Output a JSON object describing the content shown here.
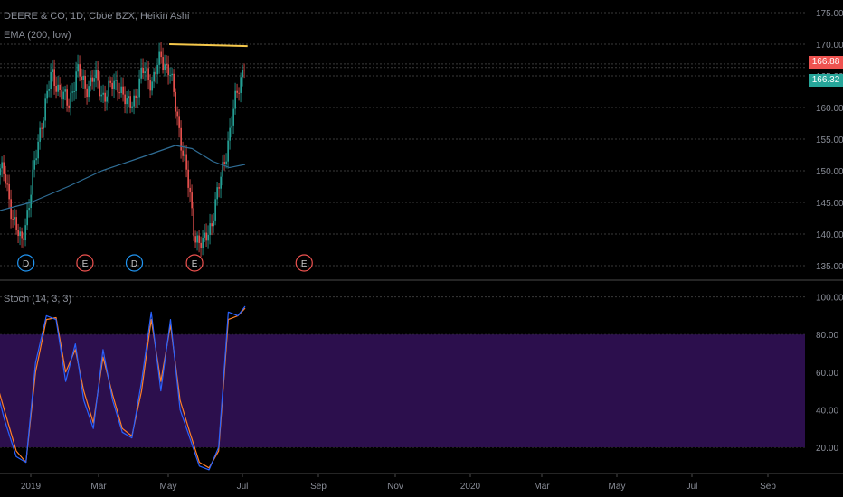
{
  "colors": {
    "background": "#000000",
    "grid": "#3a3a3a",
    "axis_text": "#8a8e98",
    "up_candle": "#26a69a",
    "down_candle": "#ef5350",
    "ema_line": "#2f6d95",
    "resistance_line": "#f5c84b",
    "stoch_k": "#2962ff",
    "stoch_d": "#ff7f27",
    "stoch_band": "#2c0f4d",
    "divider": "#4a4a4a",
    "dividend_marker": "#2196f3",
    "earnings_marker": "#ef5350"
  },
  "legend": {
    "main_title": "DEERE & CO, 1D, Cboe BZX, Heikin Ashi",
    "ema_label": "EMA (200, low)",
    "stoch_label": "Stoch (14, 3, 3)"
  },
  "price_badges": {
    "upper": "166.88",
    "lower": "166.32"
  },
  "chart_data": [
    {
      "type": "candlestick",
      "subtype": "Heikin Ashi",
      "title": "DEERE & CO, 1D, Cboe BZX, Heikin Ashi",
      "ylim": [
        133,
        177
      ],
      "y_ticks": [
        "135.00",
        "140.00",
        "145.00",
        "150.00",
        "155.00",
        "160.00",
        "165.00",
        "170.00",
        "175.00"
      ],
      "grid": true,
      "series": [
        {
          "name": "Heikin Ashi price (approx. close path)",
          "x": [
            "2018-12-02",
            "2018-12-10",
            "2018-12-17",
            "2018-12-24",
            "2019-01-02",
            "2019-01-10",
            "2019-01-18",
            "2019-01-25",
            "2019-02-01",
            "2019-02-08",
            "2019-02-15",
            "2019-02-22",
            "2019-03-01",
            "2019-03-08",
            "2019-03-15",
            "2019-03-22",
            "2019-03-29",
            "2019-04-05",
            "2019-04-12",
            "2019-04-19",
            "2019-04-26",
            "2019-05-03",
            "2019-05-10",
            "2019-05-17",
            "2019-05-24",
            "2019-05-31",
            "2019-06-07",
            "2019-06-14",
            "2019-06-21",
            "2019-06-28"
          ],
          "values": [
            152,
            149,
            143,
            138,
            148,
            158,
            165,
            163,
            160,
            166,
            163,
            165,
            162,
            163,
            164,
            160,
            162,
            166,
            164,
            168,
            166,
            158,
            150,
            140,
            138,
            142,
            148,
            155,
            162,
            168
          ]
        },
        {
          "name": "EMA (200, low)",
          "x": [
            "2018-12-02",
            "2019-01-01",
            "2019-02-01",
            "2019-03-01",
            "2019-04-01",
            "2019-05-01",
            "2019-05-15",
            "2019-06-01",
            "2019-06-15",
            "2019-06-28"
          ],
          "values": [
            143.5,
            145,
            147.5,
            150,
            152,
            154,
            153.5,
            151.5,
            150.5,
            151
          ]
        },
        {
          "name": "Resistance line",
          "x": [
            "2019-04-26",
            "2019-06-30"
          ],
          "values": [
            170.0,
            169.7
          ]
        }
      ],
      "markers": [
        {
          "label": "D",
          "x": "2018-12-28",
          "kind": "dividend"
        },
        {
          "label": "E",
          "x": "2019-02-15",
          "kind": "earnings"
        },
        {
          "label": "D",
          "x": "2019-03-28",
          "kind": "dividend"
        },
        {
          "label": "E",
          "x": "2019-05-17",
          "kind": "earnings"
        },
        {
          "label": "E",
          "x": "2019-08-16",
          "kind": "earnings"
        }
      ]
    },
    {
      "type": "line",
      "title": "Stoch (14, 3, 3)",
      "ylim": [
        7,
        108
      ],
      "y_ticks": [
        "20.00",
        "40.00",
        "60.00",
        "80.00",
        "100.00"
      ],
      "band": [
        20,
        80
      ],
      "grid": true,
      "x_tick_labels": [
        "2019",
        "Mar",
        "May",
        "Jul",
        "Sep",
        "Nov",
        "2020",
        "Mar",
        "May",
        "Jul",
        "Sep"
      ],
      "series": [
        {
          "name": "%K",
          "x": [
            "2018-12-02",
            "2018-12-10",
            "2018-12-20",
            "2018-12-28",
            "2019-01-05",
            "2019-01-14",
            "2019-01-22",
            "2019-01-30",
            "2019-02-07",
            "2019-02-14",
            "2019-02-22",
            "2019-03-02",
            "2019-03-10",
            "2019-03-18",
            "2019-03-26",
            "2019-04-03",
            "2019-04-11",
            "2019-04-19",
            "2019-04-27",
            "2019-05-05",
            "2019-05-13",
            "2019-05-21",
            "2019-05-29",
            "2019-06-06",
            "2019-06-14",
            "2019-06-22",
            "2019-06-28"
          ],
          "values": [
            55,
            35,
            15,
            12,
            65,
            90,
            88,
            55,
            75,
            45,
            30,
            72,
            45,
            28,
            25,
            55,
            92,
            50,
            88,
            40,
            25,
            10,
            8,
            20,
            92,
            90,
            95
          ]
        },
        {
          "name": "%D",
          "x": [
            "2018-12-02",
            "2018-12-10",
            "2018-12-20",
            "2018-12-28",
            "2019-01-05",
            "2019-01-14",
            "2019-01-22",
            "2019-01-30",
            "2019-02-07",
            "2019-02-14",
            "2019-02-22",
            "2019-03-02",
            "2019-03-10",
            "2019-03-18",
            "2019-03-26",
            "2019-04-03",
            "2019-04-11",
            "2019-04-19",
            "2019-04-27",
            "2019-05-05",
            "2019-05-13",
            "2019-05-21",
            "2019-05-29",
            "2019-06-06",
            "2019-06-14",
            "2019-06-22",
            "2019-06-28"
          ],
          "values": [
            58,
            40,
            18,
            12,
            60,
            88,
            89,
            60,
            72,
            50,
            33,
            68,
            48,
            30,
            26,
            50,
            88,
            55,
            85,
            45,
            28,
            12,
            9,
            18,
            88,
            90,
            94
          ]
        }
      ]
    }
  ]
}
